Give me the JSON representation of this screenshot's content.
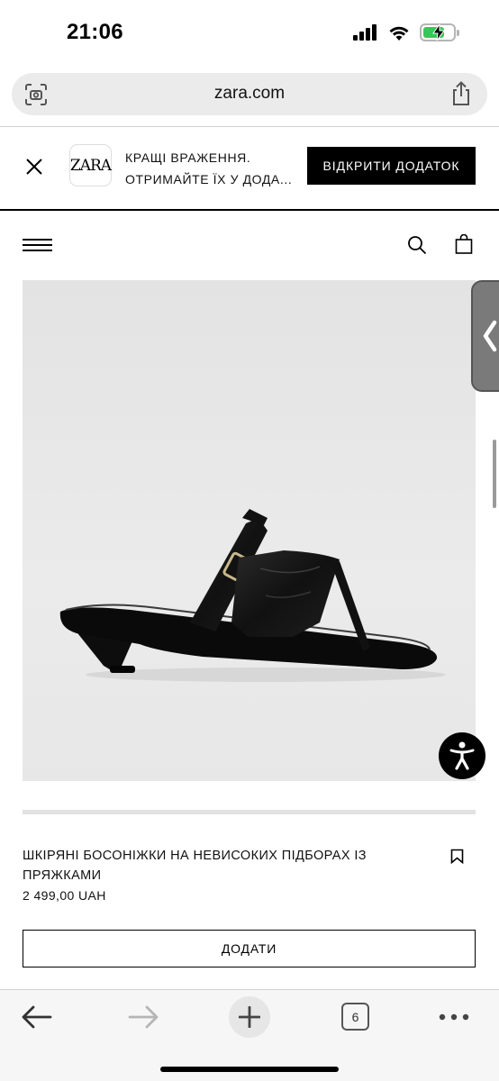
{
  "status_bar": {
    "time": "21:06",
    "icons": [
      "signal-icon",
      "wifi-icon",
      "battery-charging-icon"
    ],
    "battery_level": 0.72
  },
  "browser": {
    "url": "zara.com",
    "left_icon": "page-scan-icon",
    "right_icon": "share-icon"
  },
  "app_banner": {
    "close_icon": "close-icon",
    "logo": "ZARA",
    "line1": "КРАЩІ ВРАЖЕННЯ.",
    "line2": "ОТРИМАЙТЕ ЇХ У ДОДА...",
    "button_label": "ВІДКРИТИ ДОДАТОК"
  },
  "site_header": {
    "menu_icon": "hamburger-icon",
    "search_icon": "search-icon",
    "bag_icon": "shopping-bag-icon"
  },
  "product": {
    "title": "ШКІРЯНІ БОСОНІЖКИ НА НЕВИСОКИХ ПІДБОРАХ ІЗ ПРЯЖКАМИ",
    "price": "2 499,00 UAH",
    "add_label": "ДОДАТИ",
    "bookmark_icon": "bookmark-icon",
    "image_subject": "black leather thong sandal with buckle strap and cone heel"
  },
  "overlays": {
    "side_tab_icon": "chevron-left-icon",
    "accessibility_icon": "accessibility-icon"
  },
  "toolbar": {
    "back_icon": "arrow-left-icon",
    "forward_icon": "arrow-right-icon",
    "new_tab_icon": "plus-icon",
    "tab_count": "6",
    "more_icon": "more-dots-icon"
  },
  "colors": {
    "accent": "#000000",
    "battery": "#34c759",
    "image_bg": "#e6e6e6"
  }
}
